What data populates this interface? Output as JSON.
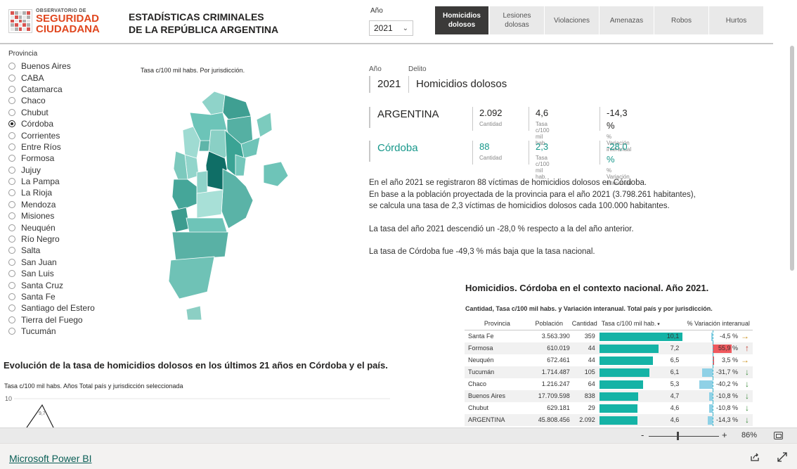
{
  "header": {
    "logo_line1": "OBSERVATORIO DE",
    "logo_line2": "SEGURIDAD",
    "logo_line3": "CIUDADANA",
    "title_line1": "ESTADÍSTICAS CRIMINALES",
    "title_line2": "DE LA REPÚBLICA ARGENTINA",
    "year_label": "Año",
    "year_value": "2021"
  },
  "tabs": [
    {
      "label_l1": "Homicidios",
      "label_l2": "dolosos",
      "active": true
    },
    {
      "label_l1": "Lesiones",
      "label_l2": "dolosas",
      "active": false
    },
    {
      "label_l1": "Violaciones",
      "label_l2": "",
      "active": false
    },
    {
      "label_l1": "Amenazas",
      "label_l2": "",
      "active": false
    },
    {
      "label_l1": "Robos",
      "label_l2": "",
      "active": false
    },
    {
      "label_l1": "Hurtos",
      "label_l2": "",
      "active": false
    }
  ],
  "provinces": {
    "title": "Provincia",
    "selected": "Córdoba",
    "items": [
      "Buenos Aires",
      "CABA",
      "Catamarca",
      "Chaco",
      "Chubut",
      "Córdoba",
      "Corrientes",
      "Entre Ríos",
      "Formosa",
      "Jujuy",
      "La Pampa",
      "La Rioja",
      "Mendoza",
      "Misiones",
      "Neuquén",
      "Río Negro",
      "Salta",
      "San Juan",
      "San Luis",
      "Santa Cruz",
      "Santa Fe",
      "Santiago del Estero",
      "Tierra del Fuego",
      "Tucumán"
    ]
  },
  "map": {
    "caption": "Tasa c/100 mil habs. Por jurisdicción.",
    "highlight_color": "#0f6e66",
    "base_color": "#5fb3aa"
  },
  "selection": {
    "ano_label": "Año",
    "delito_label": "Delito",
    "ano": "2021",
    "delito": "Homicidios dolosos"
  },
  "kpis": {
    "argentina": {
      "name": "ARGENTINA",
      "cantidad": "2.092",
      "tasa": "4,6",
      "variacion": "-14,3 %"
    },
    "provincia": {
      "name": "Córdoba",
      "cantidad": "88",
      "tasa": "2,3",
      "variacion": "-28,0 %"
    },
    "labels": {
      "cantidad": "Cantidad",
      "tasa": "Tasa c/100 mil hab.",
      "variacion": "% Variación interanual"
    }
  },
  "narrative": {
    "p1_l1": "En el año 2021 se registraron 88 víctimas de homicidios dolosos en Córdoba.",
    "p1_l2": "En base a la población proyectada de la provincia para el año 2021 (3.798.261 habitantes),",
    "p1_l3": "se calcula una tasa de 2,3 víctimas de homicidios dolosos cada 100.000 habitantes.",
    "p2": "La tasa del año 2021 descendió un -28,0 % respecto a la del año anterior.",
    "p3": "La tasa de Córdoba fue -49,3 %  más baja que la tasa nacional."
  },
  "context": {
    "title": "Homicidios. Córdoba en el contexto nacional. Año 2021.",
    "subtitle": "Cantidad, Tasa c/100 mil habs. y Variación interanual. Total país y por jurisdicción.",
    "headers": {
      "provincia": "Provincia",
      "poblacion": "Población",
      "cantidad": "Cantidad",
      "tasa": "Tasa c/100 mil hab.",
      "variacion": "% Variación interanual"
    },
    "colors": {
      "tasa_bar": "#15b3a6",
      "var_neg": "#8fd1e6",
      "var_pos": "#f0595e",
      "arrow_up": "#c0392b",
      "arrow_down": "#3a8a3a",
      "arrow_side": "#c98b12"
    },
    "rows": [
      {
        "provincia": "Santa Fe",
        "poblacion": "3.563.390",
        "cantidad": "359",
        "tasa": "10,1",
        "tasa_num": 10.1,
        "variacion": "-4,5 %",
        "var_num": -4.5,
        "trend": "side"
      },
      {
        "provincia": "Formosa",
        "poblacion": "610.019",
        "cantidad": "44",
        "tasa": "7,2",
        "tasa_num": 7.2,
        "variacion": "55,9 %",
        "var_num": 55.9,
        "trend": "up"
      },
      {
        "provincia": "Neuquén",
        "poblacion": "672.461",
        "cantidad": "44",
        "tasa": "6,5",
        "tasa_num": 6.5,
        "variacion": "3,5 %",
        "var_num": 3.5,
        "trend": "side"
      },
      {
        "provincia": "Tucumán",
        "poblacion": "1.714.487",
        "cantidad": "105",
        "tasa": "6,1",
        "tasa_num": 6.1,
        "variacion": "-31,7 %",
        "var_num": -31.7,
        "trend": "down"
      },
      {
        "provincia": "Chaco",
        "poblacion": "1.216.247",
        "cantidad": "64",
        "tasa": "5,3",
        "tasa_num": 5.3,
        "variacion": "-40,2 %",
        "var_num": -40.2,
        "trend": "down"
      },
      {
        "provincia": "Buenos Aires",
        "poblacion": "17.709.598",
        "cantidad": "838",
        "tasa": "4,7",
        "tasa_num": 4.7,
        "variacion": "-10,8 %",
        "var_num": -10.8,
        "trend": "down"
      },
      {
        "provincia": "Chubut",
        "poblacion": "629.181",
        "cantidad": "29",
        "tasa": "4,6",
        "tasa_num": 4.6,
        "variacion": "-10,8 %",
        "var_num": -10.8,
        "trend": "down"
      },
      {
        "provincia": "ARGENTINA",
        "poblacion": "45.808.456",
        "cantidad": "2.092",
        "tasa": "4,6",
        "tasa_num": 4.6,
        "variacion": "-14,3 %",
        "var_num": -14.3,
        "trend": "down"
      }
    ]
  },
  "line_chart": {
    "title": "Evolución de la tasa de homicidios dolosos en los últimos 21 años en Córdoba y el país.",
    "subtitle": "Tasa c/100 mil habs. Años Total país y jurisdicción seleccionada",
    "y_tick_top": "10",
    "peak_label": "9,7"
  },
  "zoom": {
    "minus": "-",
    "plus": "+",
    "percent": "86%"
  },
  "footer": {
    "link": "Microsoft Power BI"
  }
}
